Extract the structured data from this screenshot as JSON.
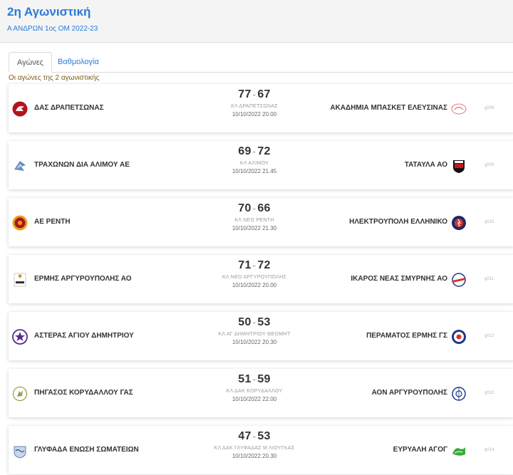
{
  "header": {
    "title": "2η Αγωνιστική",
    "subtitle": "Α ΑΝΔΡΩΝ 1ος ΟΜ 2022-23"
  },
  "tabs": [
    {
      "label": "Αγώνες"
    },
    {
      "label": "Βαθμολογία"
    }
  ],
  "caption": "Οι αγώνες της 2 αγωνιστικής",
  "games": [
    {
      "home": "ΔΑΣ ΔΡΑΠΕΤΣΩΝΑΣ",
      "home_score": "77",
      "away_score": "67",
      "away": "ΑΚΑΔΗΜΙΑ ΜΠΑΣΚΕΤ ΕΛΕΥΣΙΝΑΣ",
      "venue": "ΚΛ ΔΡΑΠΕΤΣΩΝΑΣ",
      "datetime": "10/10/2022 20.00",
      "code": "g008"
    },
    {
      "home": "ΤΡΑΧΩΝΩΝ ΔΙΑ ΑΛΙΜΟΥ ΑΕ",
      "home_score": "69",
      "away_score": "72",
      "away": "ΤΑΤΑΥΛΑ ΑΟ",
      "venue": "ΚΛ ΑΛΙΜΟΥ",
      "datetime": "10/10/2022 21.45",
      "code": "g009"
    },
    {
      "home": "ΑΕ ΡΕΝΤΗ",
      "home_score": "70",
      "away_score": "66",
      "away": "ΗΛΕΚΤΡΟΥΠΟΛΗ ΕΛΛΗΝΙΚΟ",
      "venue": "ΚΛ ΝΕΟ ΡΕΝΤΗ",
      "datetime": "10/10/2022 21.30",
      "code": "g010"
    },
    {
      "home": "ΕΡΜΗΣ ΑΡΓΥΡΟΥΠΟΛΗΣ ΑΟ",
      "home_score": "71",
      "away_score": "72",
      "away": "ΙΚΑΡΟΣ ΝΕΑΣ ΣΜΥΡΝΗΣ ΑΟ",
      "venue": "ΚΛ ΝΕΟ ΑΡΓΥΡΟΥΠΟΛΗΣ",
      "datetime": "10/10/2022 20.00",
      "code": "g011"
    },
    {
      "home": "ΑΣΤΕΡΑΣ ΑΓΙΟΥ ΔΗΜΗΤΡΙΟΥ",
      "home_score": "50",
      "away_score": "53",
      "away": "ΠΕΡΑΜΑΤΟΣ ΕΡΜΗΣ ΓΣ",
      "venue": "ΚΛ ΑΓ ΔΗΜΗΤΡΙΟΥ ΘΕΟΜΗΤ",
      "datetime": "10/10/2022 20.30",
      "code": "g012"
    },
    {
      "home": "ΠΗΓΑΣΟΣ ΚΟΡΥΔΑΛΛΟΥ ΓΑΣ",
      "home_score": "51",
      "away_score": "59",
      "away": "ΑΟΝ ΑΡΓΥΡΟΥΠΟΛΗΣ",
      "venue": "ΚΛ ΔΑΚ ΚΟΡΥΔΑΛΛΟΥ",
      "datetime": "10/10/2022 22.00",
      "code": "g013"
    },
    {
      "home": "ΓΛΥΦΑΔΑ ΕΝΩΣΗ ΣΩΜΑΤΕΙΩΝ",
      "home_score": "47",
      "away_score": "53",
      "away": "ΕΥΡΥΑΛΗ ΑΓΟΓ",
      "venue": "ΚΛ ΔΑΚ ΓΛΥΦΑΔΑΣ Μ ΛΙΟΥΓΚΑΣ",
      "datetime": "10/10/2022 20.30",
      "code": "g014"
    }
  ],
  "logos": {
    "home": [
      "drapetsona-logo-icon",
      "alimos-logo-icon",
      "renti-logo-icon",
      "ermis-logo-icon",
      "asteras-logo-icon",
      "pigasos-logo-icon",
      "glyfada-logo-icon"
    ],
    "away": [
      "elefsina-logo-icon",
      "tatavla-logo-icon",
      "ilektroupoli-logo-icon",
      "ikaros-logo-icon",
      "peramatos-logo-icon",
      "aon-logo-icon",
      "evryali-logo-icon"
    ]
  },
  "colors": {
    "accent": "#2a7ad8",
    "caption": "#7a5a1a"
  }
}
